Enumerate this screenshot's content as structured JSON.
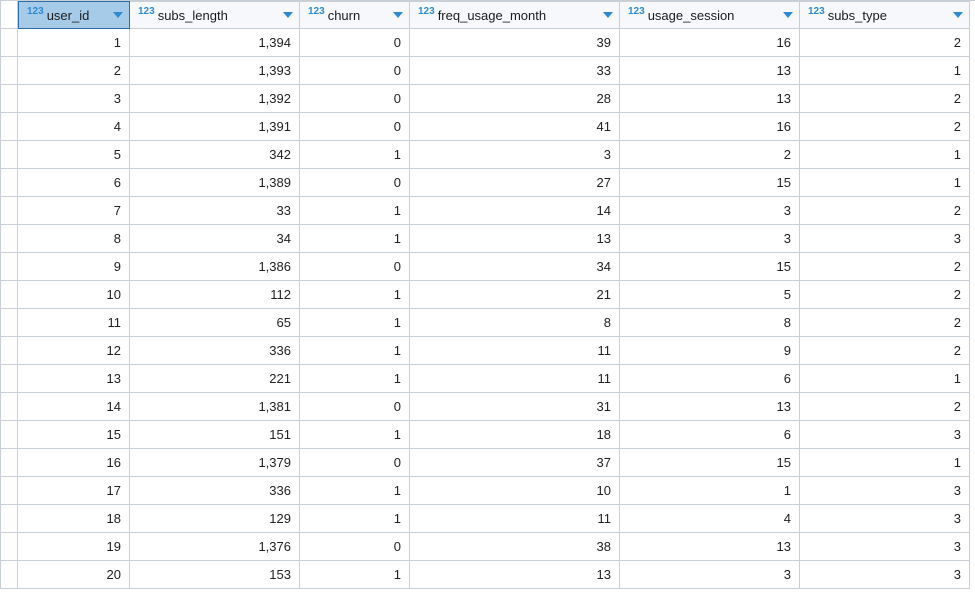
{
  "columns": [
    {
      "type_tag": "123",
      "name": "user_id",
      "selected": true
    },
    {
      "type_tag": "123",
      "name": "subs_length",
      "selected": false
    },
    {
      "type_tag": "123",
      "name": "churn",
      "selected": false
    },
    {
      "type_tag": "123",
      "name": "freq_usage_month",
      "selected": false
    },
    {
      "type_tag": "123",
      "name": "usage_session",
      "selected": false
    },
    {
      "type_tag": "123",
      "name": "subs_type",
      "selected": false
    }
  ],
  "rows": [
    {
      "user_id": "1",
      "subs_length": "1,394",
      "churn": "0",
      "freq_usage_month": "39",
      "usage_session": "16",
      "subs_type": "2",
      "selected": true
    },
    {
      "user_id": "2",
      "subs_length": "1,393",
      "churn": "0",
      "freq_usage_month": "33",
      "usage_session": "13",
      "subs_type": "1"
    },
    {
      "user_id": "3",
      "subs_length": "1,392",
      "churn": "0",
      "freq_usage_month": "28",
      "usage_session": "13",
      "subs_type": "2"
    },
    {
      "user_id": "4",
      "subs_length": "1,391",
      "churn": "0",
      "freq_usage_month": "41",
      "usage_session": "16",
      "subs_type": "2"
    },
    {
      "user_id": "5",
      "subs_length": "342",
      "churn": "1",
      "freq_usage_month": "3",
      "usage_session": "2",
      "subs_type": "1"
    },
    {
      "user_id": "6",
      "subs_length": "1,389",
      "churn": "0",
      "freq_usage_month": "27",
      "usage_session": "15",
      "subs_type": "1"
    },
    {
      "user_id": "7",
      "subs_length": "33",
      "churn": "1",
      "freq_usage_month": "14",
      "usage_session": "3",
      "subs_type": "2"
    },
    {
      "user_id": "8",
      "subs_length": "34",
      "churn": "1",
      "freq_usage_month": "13",
      "usage_session": "3",
      "subs_type": "3"
    },
    {
      "user_id": "9",
      "subs_length": "1,386",
      "churn": "0",
      "freq_usage_month": "34",
      "usage_session": "15",
      "subs_type": "2"
    },
    {
      "user_id": "10",
      "subs_length": "112",
      "churn": "1",
      "freq_usage_month": "21",
      "usage_session": "5",
      "subs_type": "2"
    },
    {
      "user_id": "11",
      "subs_length": "65",
      "churn": "1",
      "freq_usage_month": "8",
      "usage_session": "8",
      "subs_type": "2"
    },
    {
      "user_id": "12",
      "subs_length": "336",
      "churn": "1",
      "freq_usage_month": "11",
      "usage_session": "9",
      "subs_type": "2"
    },
    {
      "user_id": "13",
      "subs_length": "221",
      "churn": "1",
      "freq_usage_month": "11",
      "usage_session": "6",
      "subs_type": "1"
    },
    {
      "user_id": "14",
      "subs_length": "1,381",
      "churn": "0",
      "freq_usage_month": "31",
      "usage_session": "13",
      "subs_type": "2"
    },
    {
      "user_id": "15",
      "subs_length": "151",
      "churn": "1",
      "freq_usage_month": "18",
      "usage_session": "6",
      "subs_type": "3"
    },
    {
      "user_id": "16",
      "subs_length": "1,379",
      "churn": "0",
      "freq_usage_month": "37",
      "usage_session": "15",
      "subs_type": "1"
    },
    {
      "user_id": "17",
      "subs_length": "336",
      "churn": "1",
      "freq_usage_month": "10",
      "usage_session": "1",
      "subs_type": "3"
    },
    {
      "user_id": "18",
      "subs_length": "129",
      "churn": "1",
      "freq_usage_month": "11",
      "usage_session": "4",
      "subs_type": "3"
    },
    {
      "user_id": "19",
      "subs_length": "1,376",
      "churn": "0",
      "freq_usage_month": "38",
      "usage_session": "13",
      "subs_type": "3"
    },
    {
      "user_id": "20",
      "subs_length": "153",
      "churn": "1",
      "freq_usage_month": "13",
      "usage_session": "3",
      "subs_type": "3"
    }
  ]
}
